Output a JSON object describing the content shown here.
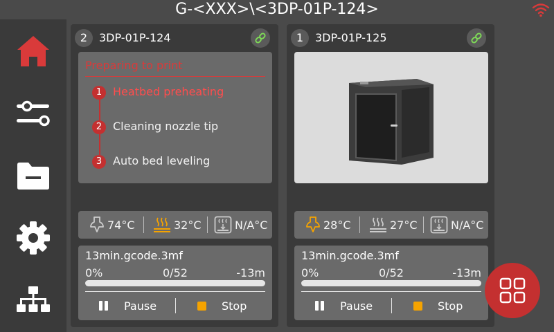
{
  "header": {
    "title": "G-<XXX>\\<3DP-01P-124>",
    "wifi_icon": "wifi-icon",
    "wifi_color": "#d93a3a"
  },
  "sidebar": {
    "items": [
      {
        "name": "home",
        "icon": "home-icon",
        "active": true
      },
      {
        "name": "controls",
        "icon": "sliders-icon"
      },
      {
        "name": "files",
        "icon": "folder-icon"
      },
      {
        "name": "settings",
        "icon": "gear-icon"
      },
      {
        "name": "network",
        "icon": "network-icon"
      }
    ]
  },
  "printers": [
    {
      "slot": "2",
      "name": "3DP-01P-124",
      "preparing": {
        "title": "Preparing to print",
        "steps": [
          {
            "num": "1",
            "label": "Heatbed preheating"
          },
          {
            "num": "2",
            "label": "Cleaning nozzle tip"
          },
          {
            "num": "3",
            "label": "Auto bed leveling"
          }
        ]
      },
      "temps": {
        "nozzle": "74°C",
        "bed": "32°C",
        "chamber": "N/A°C"
      },
      "job": {
        "file": "13min.gcode.3mf",
        "percent": "0%",
        "layers": "0/52",
        "remaining": "-13m",
        "progress": 0
      },
      "controls": {
        "pause": "Pause",
        "stop": "Stop"
      }
    },
    {
      "slot": "1",
      "name": "3DP-01P-125",
      "temps": {
        "nozzle": "28°C",
        "bed": "27°C",
        "chamber": "N/A°C"
      },
      "job": {
        "file": "13min.gcode.3mf",
        "percent": "0%",
        "layers": "0/52",
        "remaining": "-13m",
        "progress": 0
      },
      "controls": {
        "pause": "Pause",
        "stop": "Stop"
      }
    }
  ],
  "colors": {
    "accent": "#c43030",
    "heat_active": "#f5a300",
    "panel": "#6a6a6a"
  },
  "fab": {
    "icon": "grid-icon"
  }
}
